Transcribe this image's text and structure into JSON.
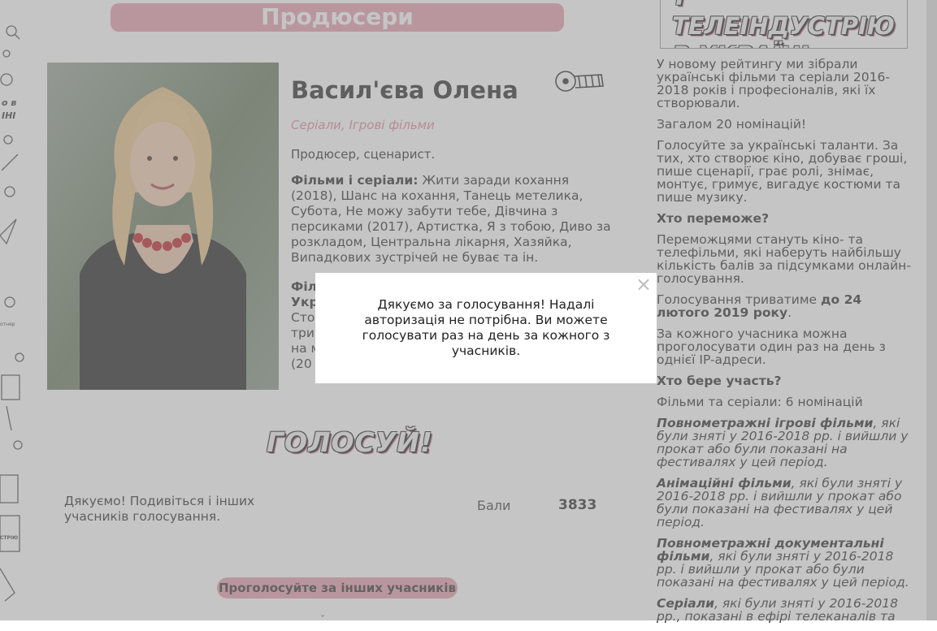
{
  "section": {
    "title": "Продюсери"
  },
  "nominee": {
    "name": "Васил'єва Олена",
    "categories": "Серіали, Ігрові фільми",
    "role": "Продюсер, сценарист.",
    "films_label": "Фільми і серіали:",
    "films_text": " Жити заради кохання (2018), Шанс на кохання, Танець метелика, Субота, Не можу забути тебе, Дівчина з персиками (2017), Артистка, Я з тобою, Диво за розкладом, Центральна лікарня, Хазяйка, Випадкових зустрічей не буває та ін.",
    "films2_lines": [
      "Філ",
      "Укр",
      "Сто",
      "три",
      "на м",
      "(20"
    ]
  },
  "vote": {
    "title": "ГОЛОСУЙ!",
    "thanks_text": "Дякуємо! Подивіться і інших учасників голосування.",
    "points_label": "Бали",
    "points_value": "3833",
    "vote_others_label": "Проголосуйте за інших учасників"
  },
  "sidebar": {
    "heading_line1": "Т ТЕЛЕІНДУСТРІЮ",
    "heading_line2": "В УКРАЇНІ",
    "p1": "У новому рейтингу ми зібрали українські фільми та серіали 2016-2018 років і професіоналів, які їх створювали.",
    "p2": "Загалом 20 номінацій!",
    "p3": "Голосуйте за українські таланти. За тих, хто створює кіно, добуває гроші, пише сценарії, грає ролі, знімає, монтує, гримує, вигадує костюми та пише музику.",
    "q1": "Хто переможе?",
    "p4": "Переможцями стануть кіно- та телефільми, які наберуть найбільшу кількість балів за підсумками онлайн-голосування.",
    "p5_a": "Голосування триватиме ",
    "p5_b": "до 24 лютого 2019 року",
    "p5_c": ".",
    "p6": "За кожного учасника можна проголосувати один раз на день з однієї IP-адреси.",
    "q2": "Хто бере участь?",
    "p7": "Фільми та серіали: 6 номінацій",
    "n1_title": " Повнометражні ігрові фільми",
    "n1_text": ", які були зняті у 2016-2018 рр. і вийшли у прокат або були показані на фестивалях у цей період.",
    "n2_title": "Анімаційні фільми",
    "n2_text": ", які були зняті у 2016-2018 рр. і вийшли у прокат або були показані на фестивалях у цей період.",
    "n3_title": "Повнометражні документальні фільми",
    "n3_text": ", які були зняті у 2016-2018 рр. і вийшли у прокат або були показані на фестивалях у цей період.",
    "n4_title": "Серіали",
    "n4_text": ", які були зняті у 2016-2018 рр., показані в ефірі телеканалів та"
  },
  "modal": {
    "message": "Дякуємо за голосування! Надалі авторизація не потрібна. Ви можете голосувати раз на день за кожного з учасників.",
    "close_symbol": "×"
  },
  "colors": {
    "accent_pink": "#e6a1b1",
    "category_pink": "#e08aa2",
    "overlay": "rgba(140,140,140,0.5)"
  }
}
